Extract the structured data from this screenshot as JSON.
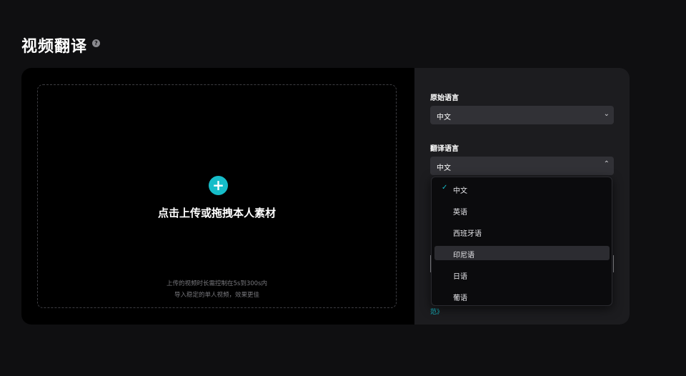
{
  "page": {
    "title": "视频翻译"
  },
  "icons": {
    "help": "help-icon",
    "plus": "plus-icon",
    "chevron_down": "chevron-down-icon",
    "chevron_up": "chevron-up-icon",
    "check": "check-icon"
  },
  "upload": {
    "main_label": "点击上传或拖拽本人素材",
    "hint_line1": "上传的视频时长需控制在5s到300s内",
    "hint_line2": "导入稳定的单人视频，效果更佳"
  },
  "settings": {
    "source_language": {
      "label": "原始语言",
      "value": "中文"
    },
    "target_language": {
      "label": "翻译语言",
      "value": "中文"
    },
    "link_fragment": "范》"
  },
  "dropdown": {
    "options": [
      "中文",
      "英语",
      "西班牙语",
      "印尼语",
      "日语",
      "葡语"
    ],
    "selected": "中文",
    "hovered": "印尼语"
  },
  "colors": {
    "accent": "#16bdc9",
    "background": "#0f0f11",
    "panel": "#1c1c1f",
    "select": "#313136"
  }
}
